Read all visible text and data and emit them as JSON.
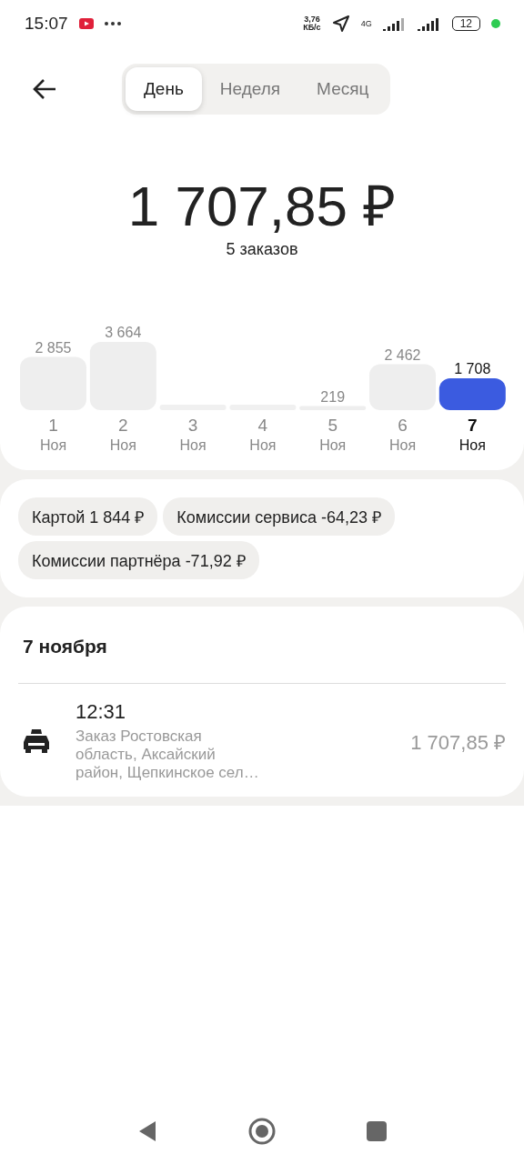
{
  "status_bar": {
    "time": "15:07",
    "speed": "3,76",
    "speed_unit": "КБ/с",
    "network": "4G",
    "battery": "12"
  },
  "tabs": [
    {
      "label": "День",
      "selected": true
    },
    {
      "label": "Неделя",
      "selected": false
    },
    {
      "label": "Месяц",
      "selected": false
    }
  ],
  "total": {
    "amount": "1 707,85 ₽",
    "orders": "5 заказов"
  },
  "chart": {
    "chart_data": {
      "type": "bar",
      "categories": [
        "1",
        "2",
        "3",
        "4",
        "5",
        "6",
        "7"
      ],
      "values": [
        2855,
        3664,
        0,
        0,
        219,
        2462,
        1708
      ],
      "value_labels": [
        "2 855",
        "3 664",
        null,
        null,
        "219",
        "2 462",
        "1 708"
      ]
    },
    "days": [
      {
        "month": "Ноя",
        "selected": false
      },
      {
        "month": "Ноя",
        "selected": false
      },
      {
        "month": "Ноя",
        "selected": false
      },
      {
        "month": "Ноя",
        "selected": false
      },
      {
        "month": "Ноя",
        "selected": false
      },
      {
        "month": "Ноя",
        "selected": false
      },
      {
        "month": "Ноя",
        "selected": true
      }
    ]
  },
  "chips": [
    "Картой 1 844 ₽",
    "Комиссии сервиса -64,23 ₽",
    "Комиссии партнёра -71,92 ₽"
  ],
  "orders_section": {
    "date": "7 ноября",
    "orders": [
      {
        "time": "12:31",
        "description": "Заказ Ростовская область, Аксайский район, Щепкинское сел…",
        "amount": "1 707,85 ₽"
      }
    ]
  }
}
